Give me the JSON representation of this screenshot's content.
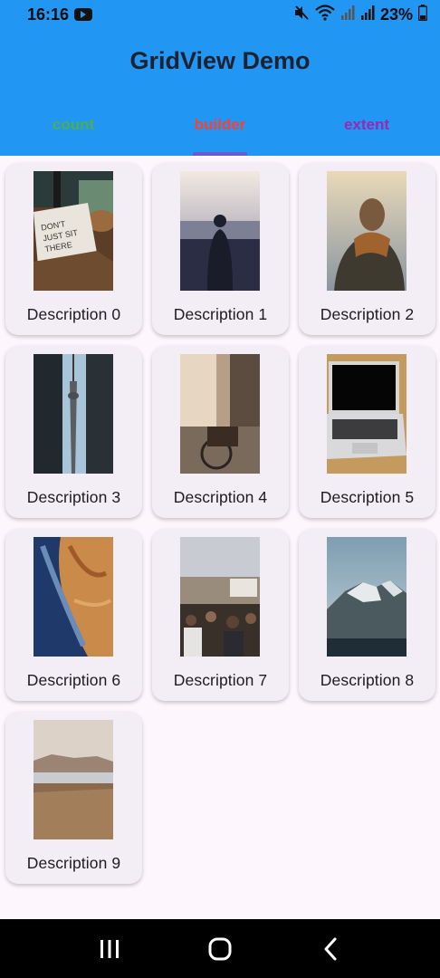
{
  "status_bar": {
    "time": "16:16",
    "battery": "23%",
    "icons": [
      "youtube-icon",
      "mute-icon",
      "wifi-icon",
      "signal-icon",
      "signal-r-icon",
      "battery-icon"
    ]
  },
  "app_bar": {
    "title": "GridView Demo",
    "color": "#2196f3"
  },
  "tabs": [
    {
      "label": "count",
      "color": "#4caf50",
      "selected": false
    },
    {
      "label": "builder",
      "color": "#f44336",
      "selected": true
    },
    {
      "label": "extent",
      "color": "#9c27b0",
      "selected": false
    }
  ],
  "grid": {
    "items": [
      {
        "label": "Description 0",
        "image": "notebook-desk-photo"
      },
      {
        "label": "Description 1",
        "image": "person-city-view-photo"
      },
      {
        "label": "Description 2",
        "image": "person-scarf-photo"
      },
      {
        "label": "Description 3",
        "image": "cn-tower-photo"
      },
      {
        "label": "Description 4",
        "image": "street-bicycle-photo"
      },
      {
        "label": "Description 5",
        "image": "laptop-photo"
      },
      {
        "label": "Description 6",
        "image": "aerial-terrain-photo"
      },
      {
        "label": "Description 7",
        "image": "crowd-street-photo"
      },
      {
        "label": "Description 8",
        "image": "snowy-mountain-photo"
      },
      {
        "label": "Description 9",
        "image": "field-lake-photo"
      }
    ]
  },
  "nav_bar": {
    "icons": [
      "recent-apps-icon",
      "home-icon",
      "back-icon"
    ]
  }
}
